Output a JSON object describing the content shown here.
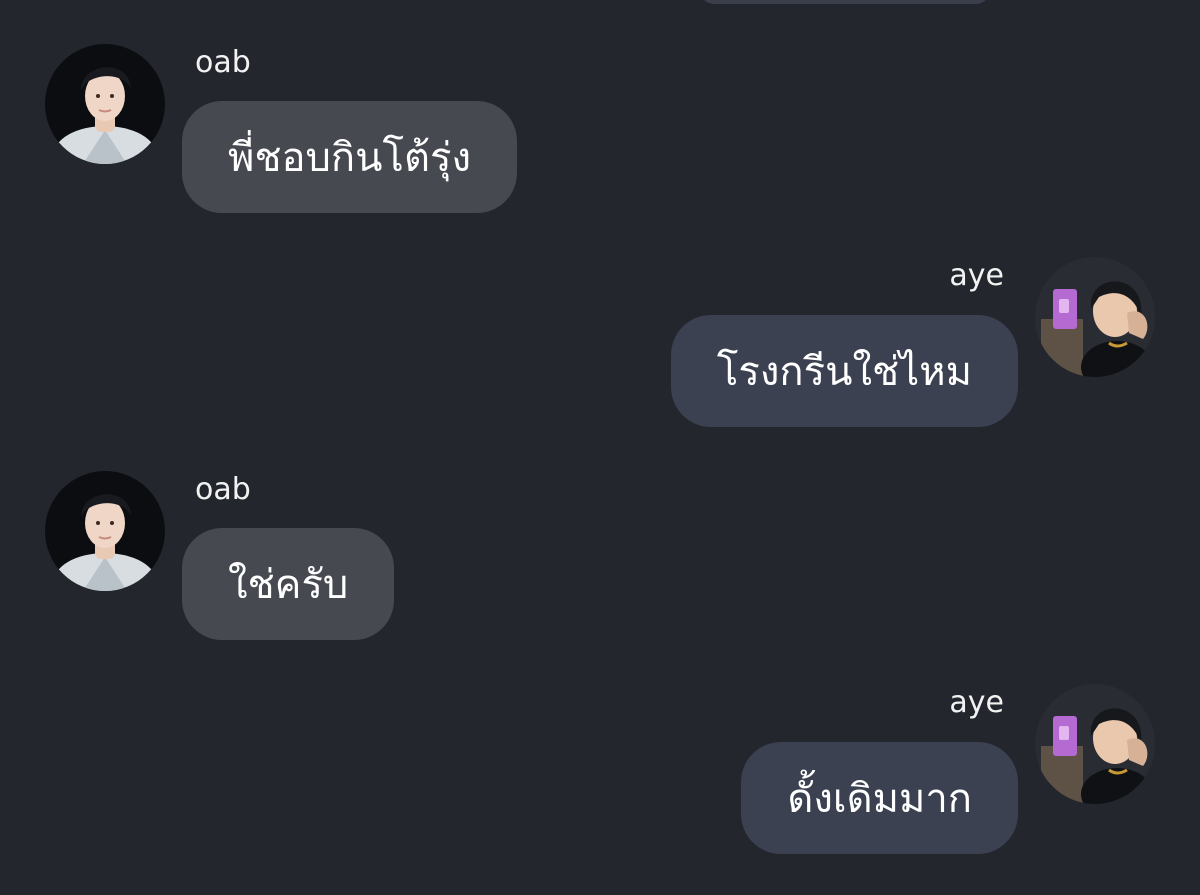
{
  "chat": {
    "messages": [
      {
        "sender": "oab",
        "text": "พี่ชอบกินโต้รุ่ง",
        "side": "left",
        "avatar_icon": "profile-photo-oab"
      },
      {
        "sender": "aye",
        "text": "โรงกรีนใช่ไหม",
        "side": "right",
        "avatar_icon": "profile-photo-aye"
      },
      {
        "sender": "oab",
        "text": "ใช่ครับ",
        "side": "left",
        "avatar_icon": "profile-photo-oab"
      },
      {
        "sender": "aye",
        "text": "ดั้งเดิมมาก",
        "side": "right",
        "avatar_icon": "profile-photo-aye"
      }
    ]
  },
  "colors": {
    "background": "#24262e",
    "incoming_bubble": "#474951",
    "outgoing_bubble": "#3b4150",
    "text": "#ffffff"
  }
}
